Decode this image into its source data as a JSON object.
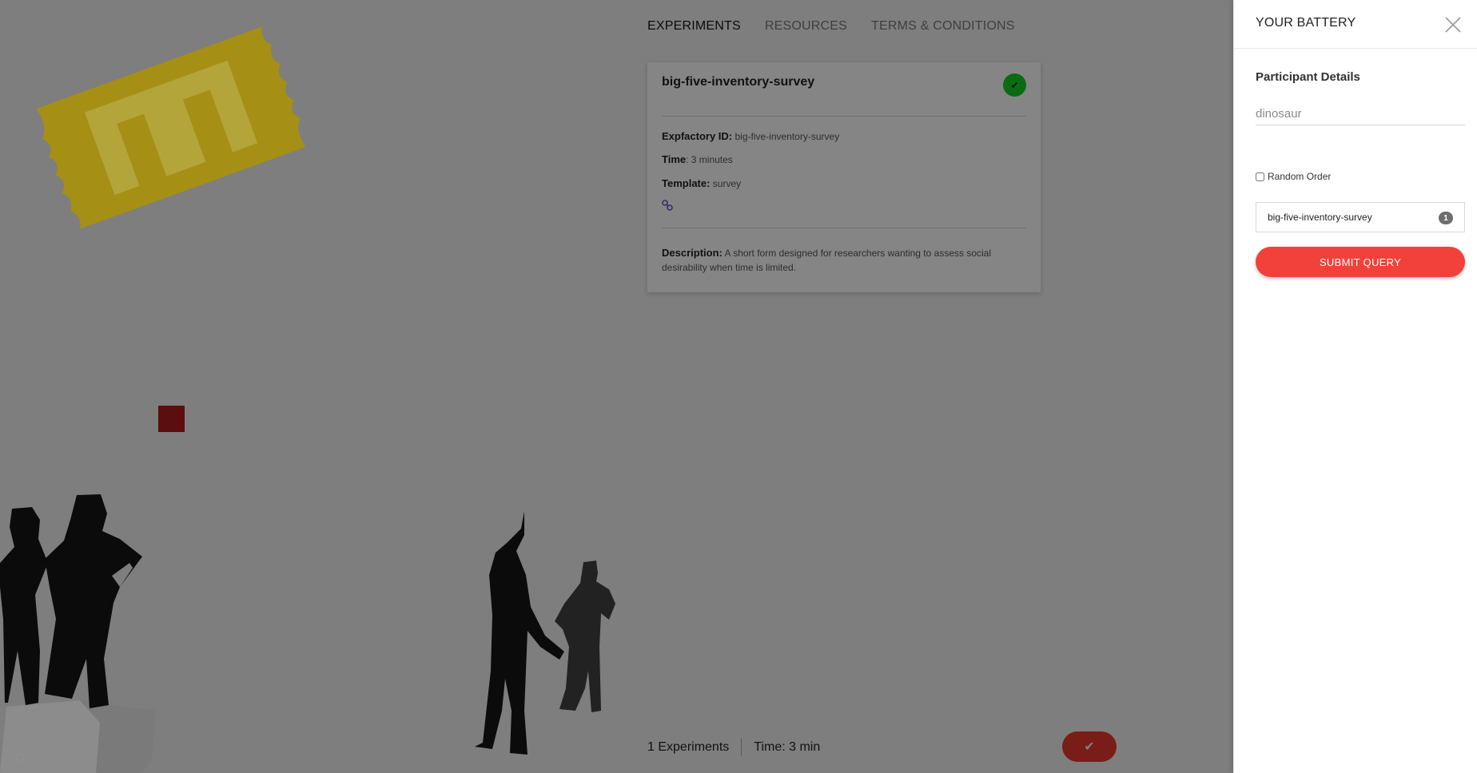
{
  "nav": {
    "tabs": [
      {
        "label": "EXPERIMENTS",
        "active": true
      },
      {
        "label": "RESOURCES",
        "active": false
      },
      {
        "label": "TERMS & CONDITIONS",
        "active": false
      }
    ]
  },
  "card": {
    "title": "big-five-inventory-survey",
    "status_icon": "check-icon",
    "expfactory_label": "Expfactory ID:",
    "expfactory_value": "big-five-inventory-survey",
    "time_label": "Time",
    "time_value": ": 3 minutes",
    "template_label": "Template:",
    "template_value": "survey",
    "link_icon": "link-icon",
    "description_label": "Description:",
    "description_value": "A short form designed for researchers wanting to assess social desirability when time is limited."
  },
  "footer": {
    "experiments": "1 Experiments",
    "time": "Time: 3 min",
    "fab_icon": "check-icon"
  },
  "panel": {
    "title": "YOUR BATTERY",
    "section_title": "Participant Details",
    "participant_value": "dinosaur",
    "random_order_label": "Random Order",
    "random_order_checked": false,
    "battery_items": [
      {
        "name": "big-five-inventory-survey",
        "badge": "1"
      }
    ],
    "submit_label": "SUBMIT QUERY"
  },
  "colors": {
    "overlay": "#7e7e7e",
    "accent": "#f2413a",
    "ticket": "#b9a21a",
    "success": "#0a6b12"
  }
}
